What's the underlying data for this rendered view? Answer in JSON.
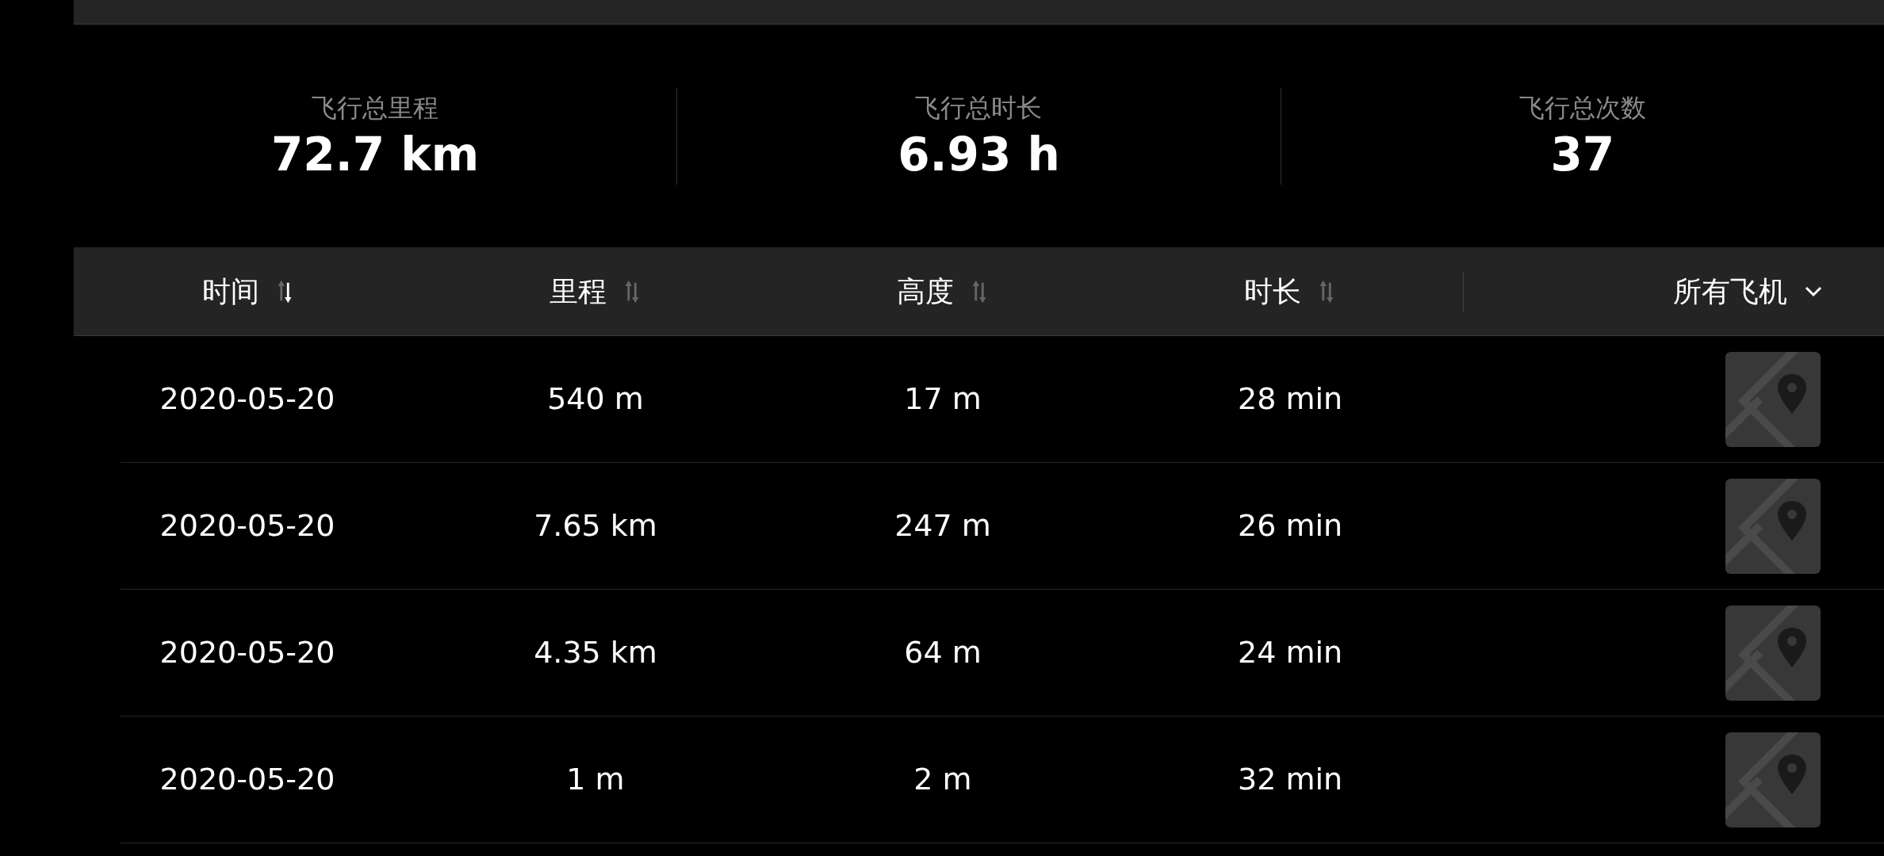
{
  "stats": [
    {
      "label": "飞行总里程",
      "value": "72.7 km"
    },
    {
      "label": "飞行总时长",
      "value": "6.93 h"
    },
    {
      "label": "飞行总次数",
      "value": "37"
    }
  ],
  "table": {
    "columns": [
      {
        "label": "时间",
        "sorted": true
      },
      {
        "label": "里程",
        "sorted": false
      },
      {
        "label": "高度",
        "sorted": false
      },
      {
        "label": "时长",
        "sorted": false
      }
    ],
    "filter": {
      "label": "所有飞机"
    },
    "rows": [
      {
        "date": "2020-05-20",
        "distance": "540 m",
        "height": "17 m",
        "duration": "28 min"
      },
      {
        "date": "2020-05-20",
        "distance": "7.65 km",
        "height": "247 m",
        "duration": "26 min"
      },
      {
        "date": "2020-05-20",
        "distance": "4.35 km",
        "height": "64 m",
        "duration": "24 min"
      },
      {
        "date": "2020-05-20",
        "distance": "1 m",
        "height": "2 m",
        "duration": "32 min"
      }
    ]
  }
}
